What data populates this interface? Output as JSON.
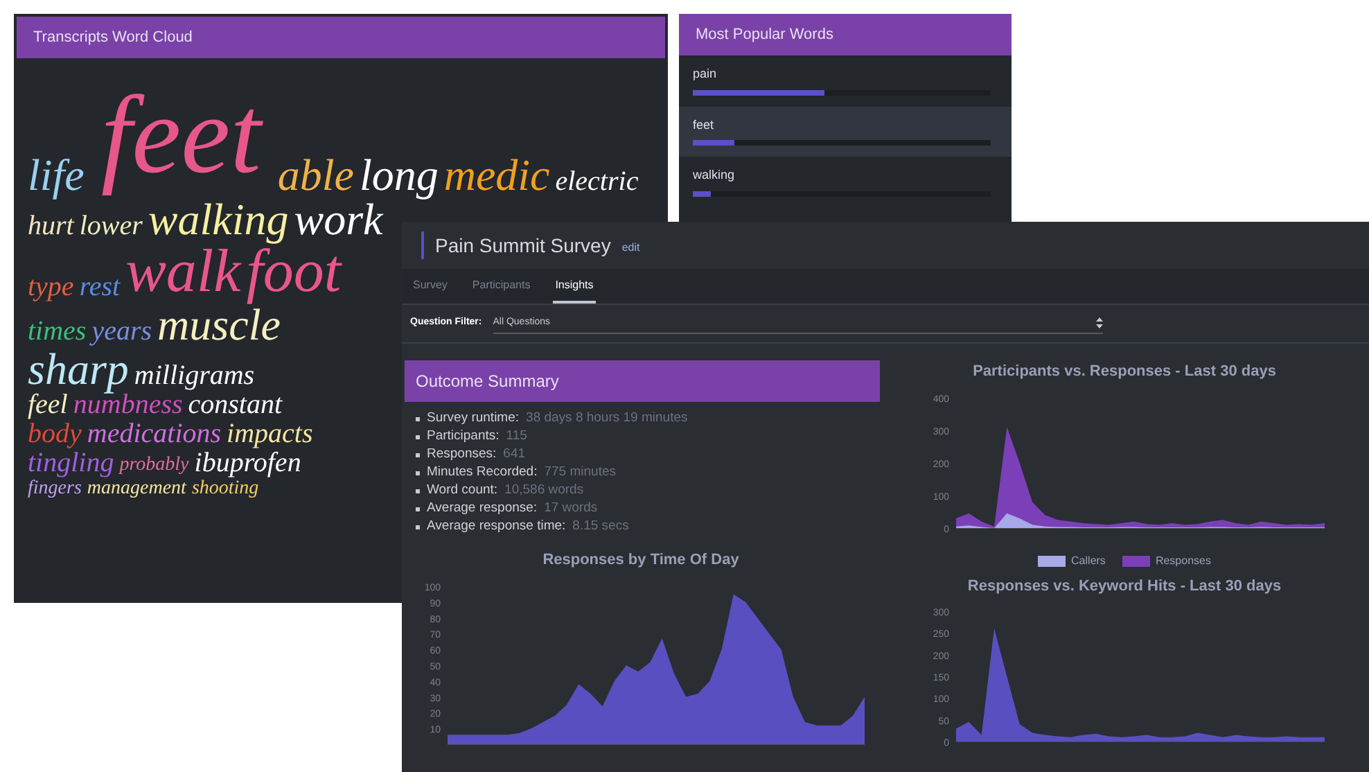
{
  "word_cloud": {
    "title": "Transcripts Word Cloud",
    "rows": [
      [
        {
          "text": "life",
          "color": "#9ad0f0",
          "kind": "lg"
        },
        {
          "text": "feet",
          "color": "#e8578a",
          "kind": "huge"
        },
        {
          "text": "able",
          "color": "#f0b24a",
          "kind": "lg"
        },
        {
          "text": "long",
          "color": "#ffffff",
          "kind": "lg"
        },
        {
          "text": "medic",
          "color": "#f0a020",
          "kind": "lg"
        },
        {
          "text": "electric",
          "color": "#ffffff",
          "kind": "md"
        }
      ],
      [
        {
          "text": "hurt",
          "color": "#f5e6c0",
          "kind": "md"
        },
        {
          "text": "lower",
          "color": "#f0f0c0",
          "kind": "md"
        },
        {
          "text": "walking",
          "color": "#f5f0a0",
          "kind": "lg"
        },
        {
          "text": "work",
          "color": "#ffffff",
          "kind": "lg"
        }
      ],
      [
        {
          "text": "type",
          "color": "#e06040",
          "kind": "md"
        },
        {
          "text": "rest",
          "color": "#5a8ee0",
          "kind": "md"
        },
        {
          "text": "walk",
          "color": "#e8578a",
          "kind": "xl"
        },
        {
          "text": "foot",
          "color": "#e8578a",
          "kind": "xl"
        }
      ],
      [
        {
          "text": "times",
          "color": "#3cc07a",
          "kind": "md"
        },
        {
          "text": "years",
          "color": "#7a8ee0",
          "kind": "md"
        },
        {
          "text": "muscle",
          "color": "#f5f0c0",
          "kind": "lg"
        }
      ],
      [
        {
          "text": "sharp",
          "color": "#bce8f5",
          "kind": "lg"
        },
        {
          "text": "milligrams",
          "color": "#ffffff",
          "kind": "md"
        }
      ],
      [
        {
          "text": "feel",
          "color": "#f5f0c0",
          "kind": "md"
        },
        {
          "text": "numbness",
          "color": "#d050c0",
          "kind": "md"
        },
        {
          "text": "constant",
          "color": "#ffffff",
          "kind": "md"
        }
      ],
      [
        {
          "text": "body",
          "color": "#e04a3a",
          "kind": "md"
        },
        {
          "text": "medications",
          "color": "#d070e0",
          "kind": "md"
        },
        {
          "text": "impacts",
          "color": "#f5e6a0",
          "kind": "md"
        }
      ],
      [
        {
          "text": "tingling",
          "color": "#a060e0",
          "kind": "md"
        },
        {
          "text": "probably",
          "color": "#e070a0",
          "kind": "sm"
        },
        {
          "text": "ibuprofen",
          "color": "#ffffff",
          "kind": "md"
        }
      ],
      [
        {
          "text": "fingers",
          "color": "#c0a0f0",
          "kind": "sm"
        },
        {
          "text": "management",
          "color": "#f5e6a0",
          "kind": "sm"
        },
        {
          "text": "shooting",
          "color": "#f0d060",
          "kind": "sm"
        }
      ]
    ]
  },
  "popular_words": {
    "title": "Most Popular Words",
    "items": [
      {
        "word": "pain",
        "level": 0.44,
        "selected": false
      },
      {
        "word": "feet",
        "level": 0.14,
        "selected": true
      },
      {
        "word": "walking",
        "level": 0.06,
        "selected": false
      }
    ]
  },
  "survey": {
    "title": "Pain Summit Survey",
    "edit_link": "edit",
    "tabs": [
      {
        "label": "Survey",
        "selected": false
      },
      {
        "label": "Participants",
        "selected": false
      },
      {
        "label": "Insights",
        "selected": true
      }
    ],
    "filter": {
      "label": "Question Filter:",
      "value": "All Questions"
    },
    "summary": {
      "title": "Outcome Summary",
      "items": [
        {
          "label": "Survey runtime:",
          "value": "38 days 8 hours 19 minutes"
        },
        {
          "label": "Participants:",
          "value": "115"
        },
        {
          "label": "Responses:",
          "value": "641"
        },
        {
          "label": "Minutes Recorded:",
          "value": "775 minutes"
        },
        {
          "label": "Word count:",
          "value": "10,586 words"
        },
        {
          "label": "Average response:",
          "value": "17 words"
        },
        {
          "label": "Average response time:",
          "value": "8.15 secs"
        }
      ]
    },
    "time_chart": {
      "chart_data": {
        "type": "area",
        "title": "Responses by Time Of Day",
        "ylim": [
          0,
          100
        ],
        "yticks": [
          10,
          20,
          30,
          40,
          50,
          60,
          70,
          80,
          90,
          100
        ],
        "series": [
          {
            "color": "#5a4fc0",
            "values": [
              6,
              6,
              6,
              6,
              6,
              6,
              7,
              10,
              14,
              18,
              25,
              38,
              32,
              24,
              40,
              50,
              46,
              52,
              67,
              45,
              30,
              32,
              40,
              60,
              95,
              90,
              80,
              70,
              60,
              30,
              14,
              12,
              12,
              12,
              18,
              30
            ]
          }
        ]
      }
    },
    "participants_chart": {
      "chart_data": {
        "type": "area",
        "title": "Participants vs. Responses - Last 30 days",
        "legend": "bottom",
        "ylim": [
          0,
          400
        ],
        "yticks": [
          0,
          100,
          200,
          300,
          400
        ],
        "series": [
          {
            "name": "Callers",
            "color": "#a7a9e8",
            "values": [
              5,
              8,
              3,
              0,
              45,
              30,
              10,
              5,
              3,
              3,
              2,
              2,
              2,
              3,
              3,
              2,
              2,
              2,
              2,
              2,
              3,
              3,
              2,
              2,
              3,
              2,
              2,
              2,
              2,
              2
            ]
          },
          {
            "name": "Responses",
            "color": "#7b3fb8",
            "values": [
              30,
              45,
              20,
              5,
              310,
              200,
              80,
              40,
              25,
              20,
              15,
              12,
              10,
              15,
              20,
              12,
              10,
              15,
              10,
              12,
              20,
              25,
              15,
              10,
              20,
              15,
              10,
              12,
              10,
              15
            ]
          }
        ]
      }
    },
    "keyword_chart": {
      "chart_data": {
        "type": "area",
        "title": "Responses vs. Keyword Hits - Last 30 days",
        "ylim": [
          0,
          300
        ],
        "yticks": [
          0,
          50,
          100,
          150,
          200,
          250,
          300
        ],
        "series": [
          {
            "color": "#5a4fc0",
            "values": [
              30,
              45,
              15,
              260,
              150,
              40,
              20,
              15,
              12,
              10,
              15,
              18,
              12,
              10,
              12,
              15,
              10,
              10,
              12,
              20,
              15,
              10,
              15,
              12,
              10,
              10,
              12,
              10,
              10,
              10
            ]
          }
        ]
      }
    }
  }
}
